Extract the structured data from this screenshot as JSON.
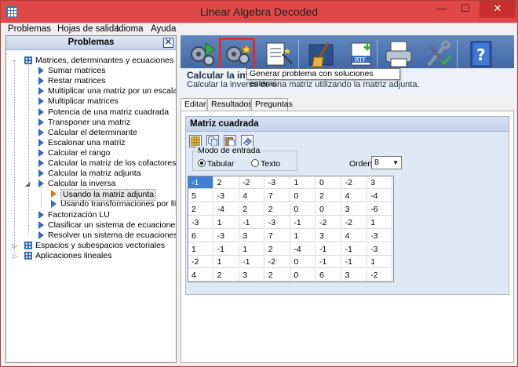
{
  "window": {
    "title": "Linear Algebra Decoded",
    "min_glyph": "—",
    "max_glyph": "☐",
    "close_glyph": "✕"
  },
  "menu": [
    "Problemas",
    "Hojas de salida",
    "Idioma",
    "Ayuda"
  ],
  "left_panel": {
    "title": "Problemas",
    "close_glyph": "✕",
    "tree": [
      {
        "label": "Matrices, determinantes y ecuaciones lineale",
        "level": 0,
        "expander": "−"
      },
      {
        "label": "Sumar matrices",
        "level": 1
      },
      {
        "label": "Restar matrices",
        "level": 1
      },
      {
        "label": "Multiplicar una matriz por un escalar",
        "level": 1
      },
      {
        "label": "Multiplicar matrices",
        "level": 1
      },
      {
        "label": "Potencia de una matriz cuadrada",
        "level": 1
      },
      {
        "label": "Transponer una matriz",
        "level": 1
      },
      {
        "label": "Calcular el determinante",
        "level": 1
      },
      {
        "label": "Escalonar una matriz",
        "level": 1
      },
      {
        "label": "Calcular el rango",
        "level": 1
      },
      {
        "label": "Calcular la matriz de los cofactores",
        "level": 1
      },
      {
        "label": "Calcular la matriz adjunta",
        "level": 1
      },
      {
        "label": "Calcular la inversa",
        "level": 1,
        "expander": "◢"
      },
      {
        "label": "Usando la matriz adjunta",
        "level": 2,
        "selected": true
      },
      {
        "label": "Usando transformaciones por fila",
        "level": 2
      },
      {
        "label": "Factorización LU",
        "level": 1
      },
      {
        "label": "Clasificar un sistema de ecuaciones lineal",
        "level": 1
      },
      {
        "label": "Resolver un sistema de ecuaciones lineal",
        "level": 1
      },
      {
        "label": "Espacios y subespacios vectoriales",
        "level": 0,
        "expander": "▷"
      },
      {
        "label": "Aplicaciones lineales",
        "level": 0,
        "expander": "▷"
      }
    ]
  },
  "toolbar": {
    "buttons": [
      {
        "icon": "gears-play-icon"
      },
      {
        "icon": "generate-integer-problem-icon",
        "selected": true
      },
      {
        "icon": "document-magic-icon"
      },
      {
        "icon": "clear-broom-icon"
      },
      {
        "icon": "export-rtf-icon"
      },
      {
        "icon": "printer-icon"
      },
      {
        "icon": "tools-settings-icon"
      },
      {
        "icon": "help-book-icon"
      }
    ],
    "tooltip": "Generar problema con soluciones enteras"
  },
  "info": {
    "title": "Calcular la inve",
    "description": "Calcular la inversa de una matriz utilizando la matriz adjunta."
  },
  "tabs": [
    "Editar",
    "Resultados",
    "Preguntas"
  ],
  "editor": {
    "section_title": "Matriz cuadrada",
    "input_mode": {
      "label": "Modo de entrada",
      "options": [
        {
          "label": "Tabular",
          "checked": true
        },
        {
          "label": "Texto",
          "checked": false
        }
      ]
    },
    "order_label": "Orden",
    "order_value": "8",
    "matrix": [
      [
        "-1",
        "2",
        "-2",
        "-3",
        "1",
        "0",
        "-2",
        "3"
      ],
      [
        "5",
        "-3",
        "4",
        "7",
        "0",
        "2",
        "4",
        "-4"
      ],
      [
        "2",
        "-4",
        "2",
        "2",
        "0",
        "0",
        "3",
        "-6"
      ],
      [
        "-3",
        "1",
        "-1",
        "-3",
        "-1",
        "-2",
        "-2",
        "1"
      ],
      [
        "6",
        "-3",
        "3",
        "7",
        "1",
        "3",
        "4",
        "-3"
      ],
      [
        "1",
        "-1",
        "1",
        "2",
        "-4",
        "-1",
        "-1",
        "-3"
      ],
      [
        "-2",
        "1",
        "-1",
        "-2",
        "0",
        "-1",
        "-1",
        "1"
      ],
      [
        "4",
        "2",
        "3",
        "2",
        "0",
        "6",
        "3",
        "-2"
      ]
    ]
  },
  "colors": {
    "titlebar": "#e04848",
    "toolbar": "#4b71ad",
    "selection": "#3f80d6",
    "highlight_box": "#e32d2d"
  }
}
